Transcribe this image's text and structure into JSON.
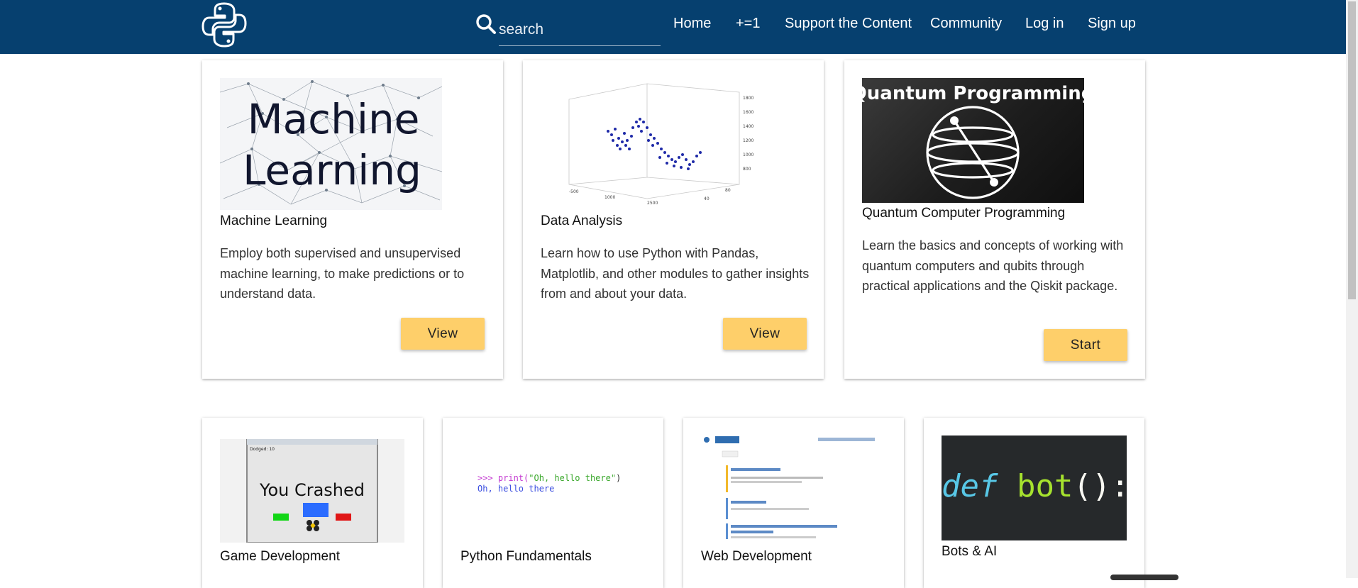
{
  "navbar": {
    "search_placeholder": "search",
    "links": [
      "Home",
      "+=1",
      "Support the Content",
      "Community",
      "Log in",
      "Sign up"
    ]
  },
  "thumbnails": {
    "machine_learning": {
      "line1": "Machine",
      "line2": "Learning"
    },
    "quantum": {
      "title": "Quantum Programming"
    },
    "python_fundamentals": {
      "line1_prompt": ">>> ",
      "line1_func": "print(",
      "line1_str": "\"Oh, hello there\"",
      "line1_close": ")",
      "line2": "Oh, hello there"
    },
    "bots": {
      "def": "def",
      "name": "bot",
      "parens": "():"
    },
    "game": {
      "crashed": "You Crashed",
      "dodged": "Dodged: 10"
    }
  },
  "cards": [
    {
      "title": "Machine Learning",
      "description": "Employ both supervised and unsupervised machine learning, to make predictions or to understand data.",
      "button": "View"
    },
    {
      "title": "Data Analysis",
      "description": "Learn how to use Python with Pandas, Matplotlib, and other modules to gather insights from and about your data.",
      "button": "View"
    },
    {
      "title": "Quantum Computer Programming",
      "description": "Learn the basics and concepts of working with quantum computers and qubits through practical applications and the Qiskit package.",
      "button": "Start"
    },
    {
      "title": "Game Development"
    },
    {
      "title": "Python Fundamentals"
    },
    {
      "title": "Web Development"
    },
    {
      "title": "Bots & AI"
    }
  ],
  "colors": {
    "navbar": "#06406f",
    "button": "#fecf6a"
  }
}
